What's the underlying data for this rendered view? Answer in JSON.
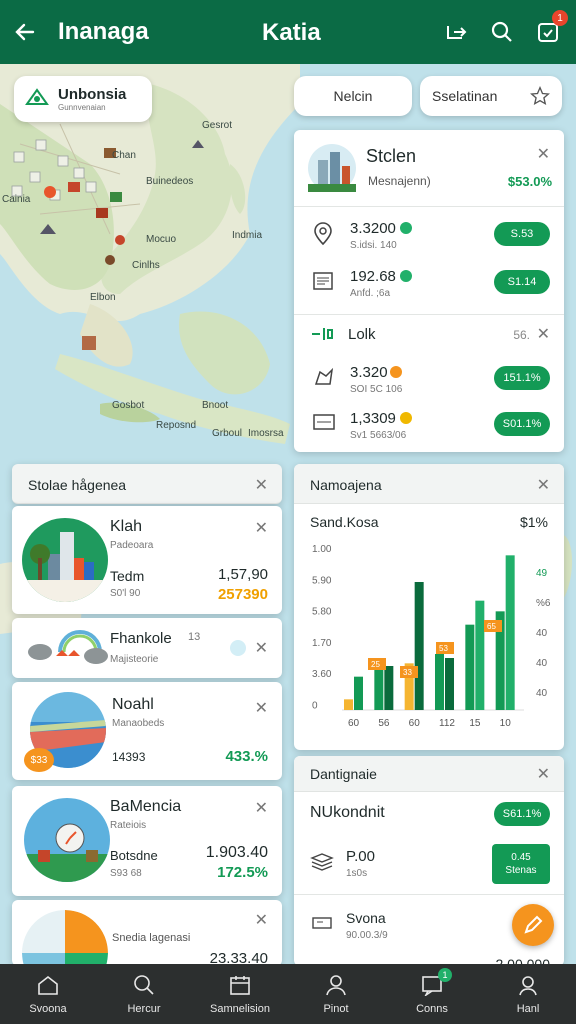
{
  "topbar": {
    "title": "Inanaga",
    "center_title": "Katia",
    "notification_count": "1"
  },
  "map": {
    "location_chip": {
      "title": "Unbonsia",
      "subtitle": "Gunnvenaian"
    },
    "labels": [
      "Gesrot",
      "Chan",
      "Buinedeos",
      "Cainia",
      "Mocuo",
      "Indmia",
      "Cinlhs",
      "Elbon",
      "Gosbot",
      "Reposnd",
      "Bnoot",
      "Grboul",
      "Imosrsa"
    ],
    "pills": {
      "left": "Nelcin",
      "right": "Sselatinan"
    }
  },
  "panel_top": {
    "title": "Stclen",
    "subtitle": "Mesnajenn)",
    "percent": "$53.0%",
    "rows": [
      {
        "value": "3.3200",
        "sub": "S.idsi. 140",
        "button": "S.53"
      },
      {
        "value": "192.68",
        "sub": "Anfd. ;6a",
        "button": "S1.14"
      }
    ],
    "section": {
      "title": "Lolk",
      "meta": "56."
    },
    "rows2": [
      {
        "value": "3.320",
        "sub": "SOI 5C 106",
        "button": "151.1%"
      },
      {
        "value": "1,3309",
        "sub": "Sv1 5663/06",
        "button": "S01.1%"
      }
    ]
  },
  "stolae": {
    "header": "Stolae hågenea",
    "items": [
      {
        "title": "Klah",
        "subtitle": "Padeoara",
        "label": "Tedm",
        "sub": "S0'l 90",
        "value1": "1,57,90",
        "value2": "257390"
      },
      {
        "title": "Fhankole",
        "subtitle": "Majisteorie",
        "badge": "13"
      },
      {
        "title": "Noahl",
        "subtitle": "Manaobeds",
        "label": "14393",
        "value2": "433.%",
        "tag": "$33"
      },
      {
        "title": "BaMencia",
        "subtitle": "Rateiois",
        "label": "Botsdne",
        "sub": "S93 68",
        "value1": "1.903.40",
        "value2": "172.5%"
      },
      {
        "title": "Snedia lagenasi",
        "value1": "23.33.40"
      }
    ]
  },
  "chart_card": {
    "header": "Namoajena",
    "title": "Sand.Kosa",
    "right_title": "$1%",
    "chart_data": {
      "type": "bar",
      "title": "Sand.Kosa",
      "categories": [
        "60",
        "56",
        "60",
        "112",
        "15",
        "10"
      ],
      "y_ticks_left": [
        "1.00",
        "5.90",
        "5.80",
        "1.70",
        "3.60",
        "0"
      ],
      "y_ticks_right": [
        "49",
        "%6",
        "40",
        "40",
        "40"
      ],
      "series": [
        {
          "color": "#f5b531",
          "values": [
            0.8,
            0,
            3.5,
            0,
            0,
            0
          ]
        },
        {
          "color": "#139a55",
          "values": [
            2.5,
            3.0,
            0,
            4.2,
            6.4,
            7.4
          ]
        },
        {
          "color": "#0a6b3c",
          "values": [
            0,
            3.3,
            9.6,
            3.9,
            0,
            0
          ]
        },
        {
          "color": "#21b06a",
          "values": [
            0,
            0,
            0,
            0,
            8.2,
            11.6
          ]
        }
      ],
      "callouts": [
        "25",
        "33",
        "53",
        "65"
      ],
      "ylim": [
        0,
        12
      ]
    }
  },
  "bottom_right": {
    "header": "Dantignaie",
    "title": "NUkondnit",
    "title_button": "S61.1%",
    "rows": [
      {
        "value": "P.00",
        "sub": "1s0s",
        "button_line1": "0.45",
        "button_line2": "Stenas"
      },
      {
        "value": "Svona",
        "sub": "90.00.3/9"
      }
    ],
    "partial": "2.00.000"
  },
  "bottom_nav": [
    {
      "label": "Svoona",
      "icon": "home-icon"
    },
    {
      "label": "Hercur",
      "icon": "search-icon"
    },
    {
      "label": "Samnelision",
      "icon": "calendar-icon"
    },
    {
      "label": "Pinot",
      "icon": "user-icon"
    },
    {
      "label": "Conns",
      "icon": "chat-icon",
      "badge": "1"
    },
    {
      "label": "Hanl",
      "icon": "profile-icon"
    }
  ],
  "colors": {
    "brand": "#0b6b45",
    "accent": "#139a55",
    "orange": "#f5941e"
  }
}
